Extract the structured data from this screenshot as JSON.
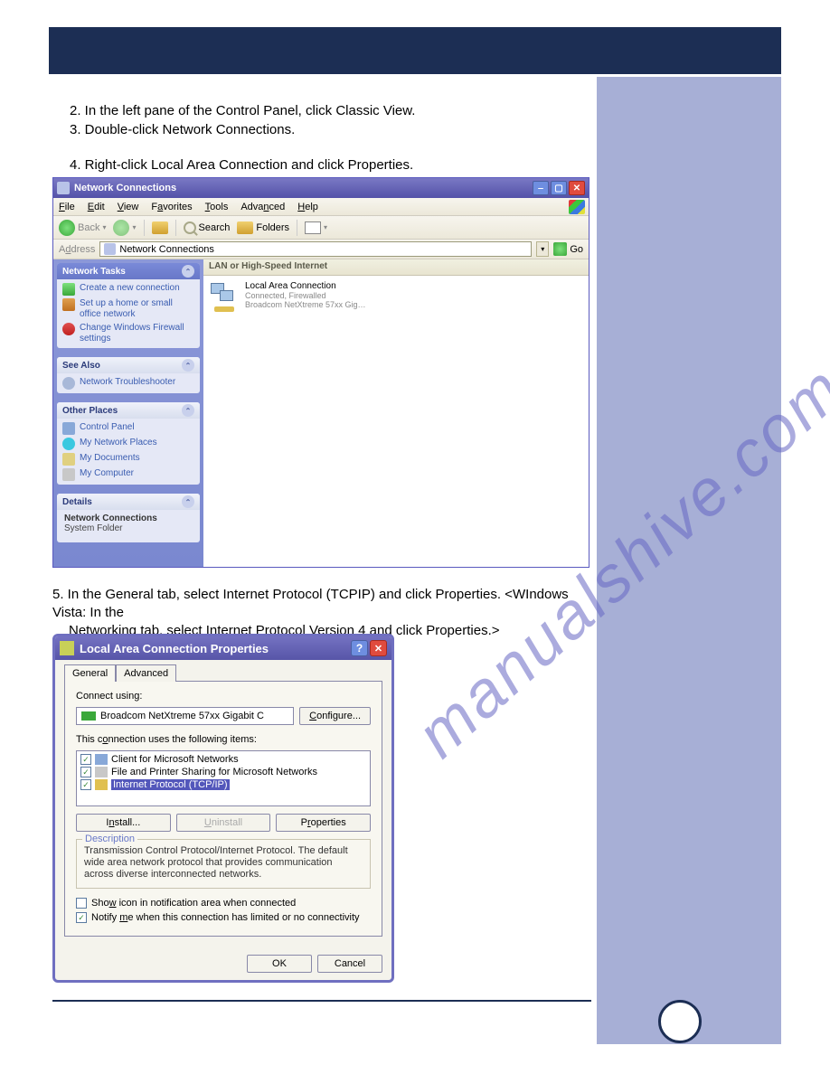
{
  "intro": {
    "line1": "2. In the left pane of the Control Panel, click Classic View.",
    "line2": "3. Double-click Network Connections.",
    "line3": "4. Right-click Local Area Connection and click Properties."
  },
  "step5": {
    "line1": "5. In the General tab, select Internet Protocol (TCPIP) and click Properties. <WIndows Vista: In the ",
    "line2": "Networking tab, select Internet Protocol Version 4 and click Properties.>"
  },
  "window1": {
    "title": "Network Connections",
    "menus": [
      "File",
      "Edit",
      "View",
      "Favorites",
      "Tools",
      "Advanced",
      "Help"
    ],
    "toolbar": {
      "back": "Back",
      "search": "Search",
      "folders": "Folders"
    },
    "address": {
      "label": "Address",
      "value": "Network Connections",
      "go": "Go"
    },
    "sidebar": {
      "tasks": {
        "title": "Network Tasks",
        "items": [
          "Create a new connection",
          "Set up a home or small office network",
          "Change Windows Firewall settings"
        ]
      },
      "seealso": {
        "title": "See Also",
        "items": [
          "Network Troubleshooter"
        ]
      },
      "other": {
        "title": "Other Places",
        "items": [
          "Control Panel",
          "My Network Places",
          "My Documents",
          "My Computer"
        ]
      },
      "details": {
        "title": "Details",
        "name": "Network Connections",
        "type": "System Folder"
      }
    },
    "main": {
      "section": "LAN or High-Speed Internet",
      "conn": {
        "name": "Local Area Connection",
        "status": "Connected, Firewalled",
        "device": "Broadcom NetXtreme 57xx Gig…"
      }
    }
  },
  "dialog": {
    "title": "Local Area Connection Properties",
    "tabs": {
      "general": "General",
      "advanced": "Advanced"
    },
    "connect_using": "Connect using:",
    "adapter": "Broadcom NetXtreme 57xx Gigabit C",
    "configure": "Configure...",
    "items_label": "This connection uses the following items:",
    "items": [
      {
        "name": "Client for Microsoft Networks",
        "checked": true
      },
      {
        "name": "File and Printer Sharing for Microsoft Networks",
        "checked": true
      },
      {
        "name": "Internet Protocol (TCP/IP)",
        "checked": true,
        "selected": true
      }
    ],
    "buttons": {
      "install": "Install...",
      "uninstall": "Uninstall",
      "properties": "Properties"
    },
    "description": {
      "label": "Description",
      "text": "Transmission Control Protocol/Internet Protocol. The default wide area network protocol that provides communication across diverse interconnected networks."
    },
    "opts": {
      "show_icon": "Show icon in notification area when connected",
      "notify": "Notify me when this connection has limited or no connectivity"
    },
    "footer": {
      "ok": "OK",
      "cancel": "Cancel"
    }
  },
  "watermark": "manualshive.com"
}
